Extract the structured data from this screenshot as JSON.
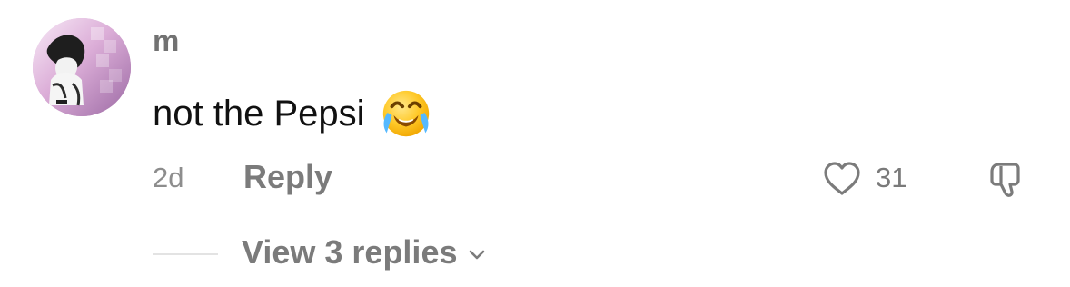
{
  "comment": {
    "username": "m",
    "text": "not the Pepsi",
    "emoji_icon": "face-with-tears-of-joy-icon",
    "timestamp": "2d",
    "reply_label": "Reply",
    "likes": "31",
    "like_icon": "heart-icon",
    "dislike_icon": "thumbs-down-icon"
  },
  "replies": {
    "label": "View 3 replies",
    "icon": "chevron-down-icon"
  },
  "colors": {
    "text_primary": "#111111",
    "text_secondary": "#7b7b7b",
    "divider": "#e3e3e3",
    "background": "#ffffff"
  }
}
